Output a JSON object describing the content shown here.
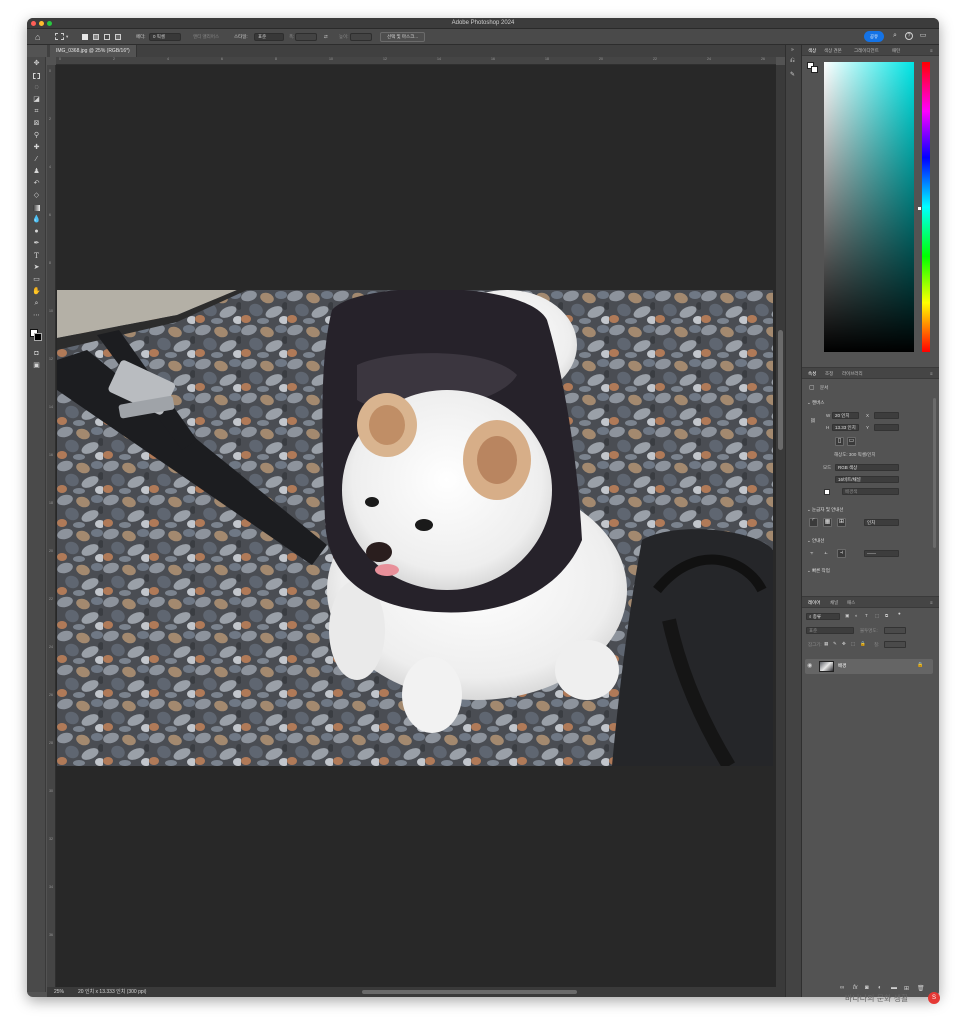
{
  "app": {
    "title": "Adobe Photoshop 2024"
  },
  "options_bar": {
    "feather_label": "페더:",
    "feather_value": "0 픽셀",
    "antialias_label": "앤티 앨리어스",
    "style_label": "스타일:",
    "style_value": "표준",
    "width_label": "폭:",
    "height_label": "높이:",
    "select_mask_button": "선택 및 마스크...",
    "share_button": "공유",
    "swap_icon": "⇄"
  },
  "document": {
    "tab_label": "IMG_0368.jpg @ 25% (RGB/16*)",
    "zoom": "25%",
    "size_info": "20 인치 x 13.333 인치 (300 ppi)"
  },
  "rulers": {
    "top": [
      "0",
      "2",
      "4",
      "6",
      "8",
      "10",
      "12",
      "14",
      "16",
      "18",
      "20",
      "22",
      "24",
      "26"
    ],
    "left": [
      "0",
      "2",
      "4",
      "6",
      "8",
      "10",
      "12",
      "14",
      "16",
      "18",
      "20",
      "22",
      "24",
      "26",
      "28",
      "30",
      "32",
      "34",
      "36"
    ]
  },
  "color_panel": {
    "tabs": [
      "색상",
      "색상 견본",
      "그레이디언트",
      "패턴"
    ],
    "active_tab": "색상",
    "hue_color": "#00e5e5"
  },
  "properties_panel": {
    "tabs": [
      "속성",
      "조정",
      "라이브러리"
    ],
    "active_tab": "속성",
    "doc_label": "문서",
    "canvas_section": "캔버스",
    "w_label": "W",
    "w_value": "20 인치",
    "h_label": "H",
    "h_value": "13.33 인치",
    "x_label": "X",
    "y_label": "Y",
    "resolution": "해상도: 300 픽셀/인치",
    "mode_label": "모드",
    "mode_value": "RGB 색상",
    "depth_value": "16비트/채널",
    "fill_label": "배경색",
    "rulers_section": "눈금자 및 안내선",
    "ruler_unit": "인치",
    "guides_section": "안내선",
    "quick_actions": "빠른 작업"
  },
  "layers_panel": {
    "tabs": [
      "레이어",
      "채널",
      "패스"
    ],
    "active_tab": "레이어",
    "filter_placeholder": "종류",
    "blend_mode": "표준",
    "opacity_label": "불투명도:",
    "lock_label": "잠그기:",
    "fill_label": "칠:",
    "layer_name": "배경"
  },
  "watermark": {
    "text": "바나나의 문화 생활",
    "badge": "S"
  },
  "icons": {
    "home": "⌂",
    "search": "⌕",
    "help": "?",
    "workspace": "▭",
    "eye": "◉",
    "lock": "🔒",
    "collapse": "»"
  },
  "colors": {
    "accent": "#1473e6",
    "canvas_bg": "#282828",
    "panel_bg": "#535353"
  }
}
